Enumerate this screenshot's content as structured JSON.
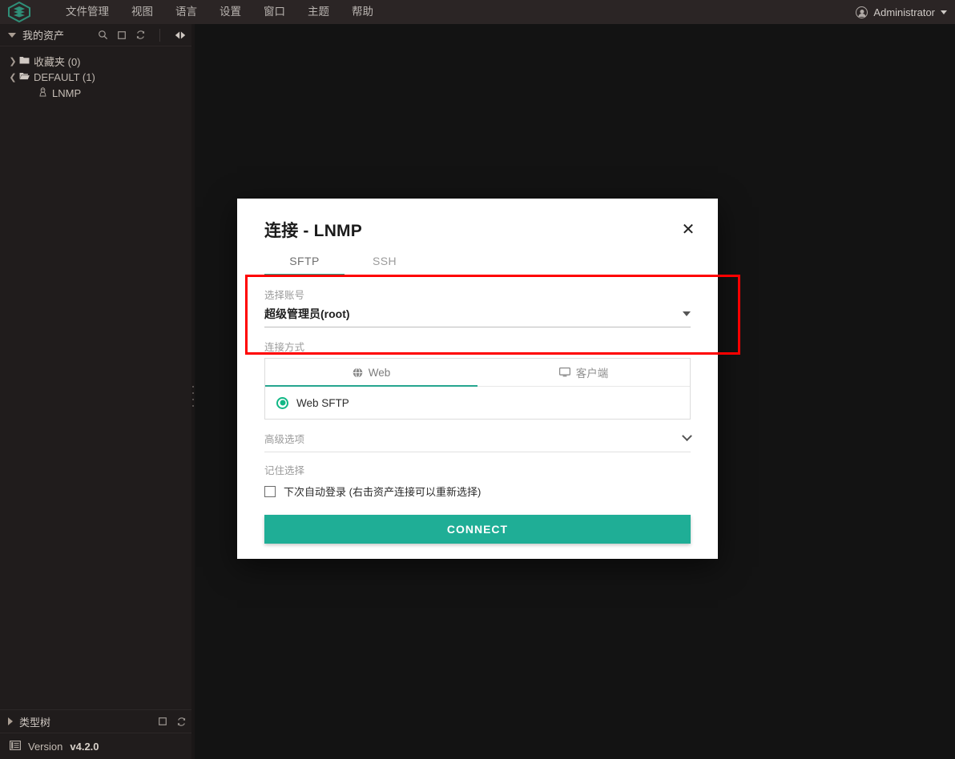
{
  "menubar": {
    "logo_name": "app-logo",
    "items": [
      {
        "label": "文件管理"
      },
      {
        "label": "视图"
      },
      {
        "label": "语言"
      },
      {
        "label": "设置"
      },
      {
        "label": "窗口"
      },
      {
        "label": "主题"
      },
      {
        "label": "帮助"
      }
    ],
    "user": {
      "name": "Administrator",
      "avatar_icon": "user-avatar-icon",
      "caret_icon": "chevron-down-icon"
    }
  },
  "sidebar": {
    "header": {
      "title": "我的资产",
      "collapse_icon": "triangle-down-icon",
      "tools": [
        {
          "name": "search-icon",
          "glyph": "⌕"
        },
        {
          "name": "maximize-icon",
          "glyph": "▢"
        },
        {
          "name": "refresh-icon",
          "glyph": "⟳"
        },
        {
          "name": "split-pane-icon",
          "glyph": "◀▶"
        }
      ]
    },
    "tree": [
      {
        "label": "收藏夹 (0)",
        "icon": "folder-closed-icon",
        "chevron": "chevron-right-icon",
        "expanded": false
      },
      {
        "label": "DEFAULT (1)",
        "icon": "folder-open-icon",
        "chevron": "chevron-down-icon",
        "expanded": true
      }
    ],
    "child": {
      "label": "LNMP",
      "icon": "linux-penguin-icon"
    },
    "typetree": {
      "label": "类型树",
      "expand_icon": "triangle-right-icon",
      "tools": [
        {
          "name": "maximize-icon",
          "glyph": "▢"
        },
        {
          "name": "refresh-icon",
          "glyph": "⟳"
        }
      ]
    },
    "version": {
      "icon": "version-list-icon",
      "label": "Version",
      "value": "v4.2.0"
    }
  },
  "dialog": {
    "title": "连接 - LNMP",
    "close_icon": "close-icon",
    "tabs": [
      {
        "label": "SFTP",
        "active": true
      },
      {
        "label": "SSH",
        "active": false
      }
    ],
    "account": {
      "label": "选择账号",
      "value": "超级管理员(root)",
      "caret_icon": "dropdown-caret-icon"
    },
    "method": {
      "label": "连接方式",
      "tabs": [
        {
          "label": "Web",
          "icon": "globe-icon",
          "active": true
        },
        {
          "label": "客户端",
          "icon": "monitor-icon",
          "active": false
        }
      ],
      "radio": {
        "label": "Web SFTP",
        "selected": true
      }
    },
    "advanced": {
      "label": "高级选项",
      "chevron_icon": "chevron-down-icon"
    },
    "remember": {
      "label": "记住选择",
      "checkbox_label": "下次自动登录 (右击资产连接可以重新选择)",
      "checked": false
    },
    "connect_label": "CONNECT"
  },
  "annotation": {
    "name": "red-highlight-box",
    "color": "#ff0000"
  },
  "colors": {
    "accent_teal": "#1fae96",
    "menubar_bg": "#2b2525",
    "sidebar_bg": "#201c1c",
    "canvas_bg": "#131313",
    "dialog_bg": "#ffffff"
  }
}
